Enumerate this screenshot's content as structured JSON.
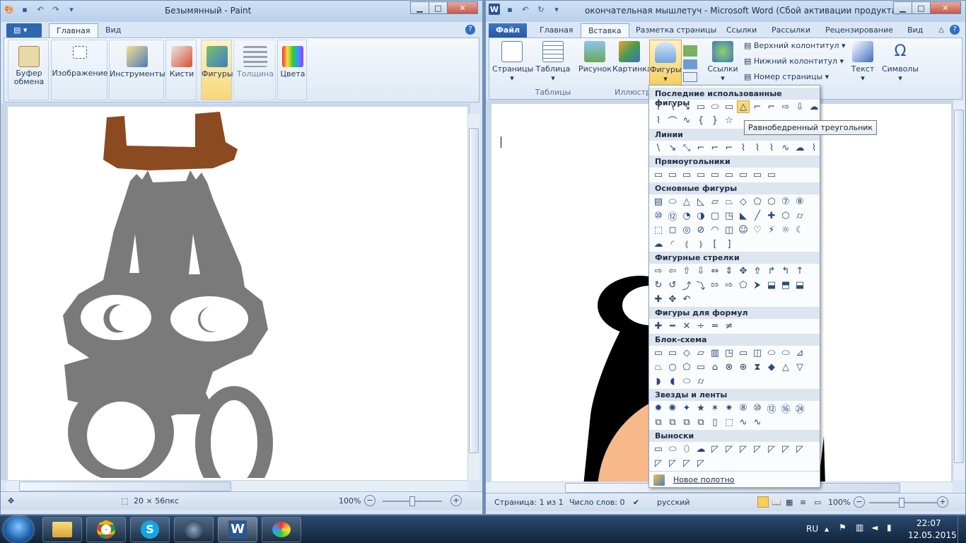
{
  "paint": {
    "title": "Безымянный - Paint",
    "tabs": [
      "Главная",
      "Вид"
    ],
    "groups": {
      "clipboard": "Буфер обмена",
      "image": "Изображение",
      "tools": "Инструменты",
      "brushes": "Кисти",
      "shapes": "Фигуры",
      "size": "Толщина",
      "colors": "Цвета"
    },
    "status": {
      "selection_size": "20 × 56пкс",
      "zoom": "100%"
    },
    "colors": {
      "antler": "#8b4a1f",
      "body": "#7a7a7a",
      "eye": "#ffffff"
    }
  },
  "word": {
    "title": "окончательная мышлетуч - Microsoft Word (Сбой активации продукта)",
    "tabs": [
      "Файл",
      "Главная",
      "Вставка",
      "Разметка страницы",
      "Ссылки",
      "Рассылки",
      "Рецензирование",
      "Вид"
    ],
    "active_tab": "Вставка",
    "ribbon": {
      "pages": "Страницы",
      "table": "Таблица",
      "tables_group": "Таблицы",
      "picture": "Рисунок",
      "clipart": "Картинка",
      "shapes": "Фигуры",
      "illustrations_group": "Иллюстра",
      "links": "Ссылки",
      "header": "Верхний колонтитул",
      "footer": "Нижний колонтитул",
      "page_number": "Номер страницы",
      "text": "Текст",
      "symbols": "Символы"
    },
    "status": {
      "page": "Страница: 1 из 1",
      "words": "Число слов: 0",
      "language": "русский",
      "zoom": "100%"
    },
    "colors": {
      "skin": "#f7b98a",
      "black": "#000000"
    }
  },
  "shapes_menu": {
    "sections": [
      "Последние использованные фигуры",
      "Линии",
      "Прямоугольники",
      "Основные фигуры",
      "Фигурные стрелки",
      "Фигуры для формул",
      "Блок-схема",
      "Звезды и ленты",
      "Выноски"
    ],
    "new_canvas": "Новое полотно",
    "tooltip": "Равнобедренный треугольник"
  },
  "taskbar": {
    "language": "RU",
    "time": "22:07",
    "date": "12.05.2015"
  }
}
